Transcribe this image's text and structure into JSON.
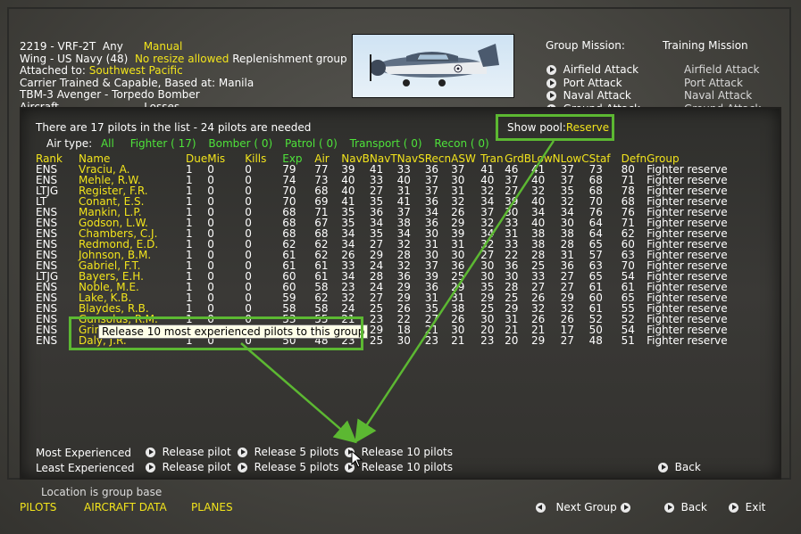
{
  "group": {
    "line1_id": "2219 - VRF-2T",
    "line1_any": "Any",
    "line1_manual": "Manual",
    "line2_wing": "Wing - US Navy (48)",
    "line2_resize": "No resize allowed",
    "line2_replenish": "Replenishment group",
    "line3_label": "Attached to:",
    "line3_value": "Southwest Pacific",
    "line4": "Carrier Trained & Capable, Based at:  Manila",
    "line5": "TBM-3 Avenger - Torpedo Bomber",
    "line6_a": "Aircraft",
    "line6_b": "Losses"
  },
  "missions": {
    "header_group": "Group Mission:",
    "header_training": "Training Mission",
    "items": [
      {
        "group": "Airfield Attack",
        "training": "Airfield Attack"
      },
      {
        "group": "Port Attack",
        "training": "Port Attack"
      },
      {
        "group": "Naval Attack",
        "training": "Naval Attack"
      },
      {
        "group": "Ground Attack",
        "training": "Ground Attack"
      }
    ]
  },
  "panel": {
    "summary": "There are 17 pilots in the list - 24 pilots are needed",
    "show_pool_label": "Show pool:",
    "show_pool_value": "Reserve",
    "air_type_label": "Air type:",
    "filters": [
      "All",
      "Fighter ( 17)",
      "Bomber ( 0)",
      "Patrol ( 0)",
      "Transport ( 0)",
      "Recon ( 0)"
    ]
  },
  "columns": [
    "Rank",
    "Name",
    "Due",
    "Mis",
    "Kills",
    "Exp",
    "Air",
    "NavB",
    "NavT",
    "NavS",
    "Recn",
    "ASW",
    "Tran",
    "GrdB",
    "LowN",
    "LowC",
    "Staf",
    "Defn",
    "Group"
  ],
  "pilots": [
    [
      "ENS",
      "Vraciu, A.",
      "1",
      "0",
      "0",
      "79",
      "77",
      "39",
      "41",
      "33",
      "36",
      "37",
      "41",
      "46",
      "41",
      "37",
      "73",
      "80",
      "Fighter reserve"
    ],
    [
      "ENS",
      "Mehle, R.W.",
      "1",
      "0",
      "0",
      "74",
      "73",
      "40",
      "33",
      "40",
      "37",
      "30",
      "40",
      "37",
      "40",
      "37",
      "68",
      "71",
      "Fighter reserve"
    ],
    [
      "LTJG",
      "Register, F.R.",
      "1",
      "0",
      "0",
      "70",
      "68",
      "40",
      "27",
      "31",
      "37",
      "31",
      "32",
      "27",
      "32",
      "35",
      "68",
      "78",
      "Fighter reserve"
    ],
    [
      "LT",
      "Conant, E.S.",
      "1",
      "0",
      "0",
      "70",
      "69",
      "41",
      "35",
      "41",
      "36",
      "32",
      "34",
      "39",
      "40",
      "32",
      "70",
      "68",
      "Fighter reserve"
    ],
    [
      "ENS",
      "Mankin, L.P.",
      "1",
      "0",
      "0",
      "68",
      "71",
      "35",
      "36",
      "37",
      "34",
      "26",
      "37",
      "30",
      "34",
      "34",
      "76",
      "76",
      "Fighter reserve"
    ],
    [
      "ENS",
      "Godson, L.W.",
      "1",
      "0",
      "0",
      "68",
      "67",
      "35",
      "34",
      "38",
      "36",
      "29",
      "32",
      "33",
      "40",
      "30",
      "64",
      "71",
      "Fighter reserve"
    ],
    [
      "ENS",
      "Chambers, C.J.",
      "1",
      "0",
      "0",
      "68",
      "68",
      "34",
      "35",
      "34",
      "30",
      "39",
      "34",
      "31",
      "38",
      "38",
      "64",
      "62",
      "Fighter reserve"
    ],
    [
      "ENS",
      "Redmond, E.D.",
      "1",
      "0",
      "0",
      "62",
      "62",
      "34",
      "27",
      "32",
      "31",
      "31",
      "32",
      "33",
      "38",
      "28",
      "65",
      "60",
      "Fighter reserve"
    ],
    [
      "ENS",
      "Johnson, B.M.",
      "1",
      "0",
      "0",
      "61",
      "62",
      "26",
      "29",
      "28",
      "30",
      "30",
      "27",
      "22",
      "28",
      "31",
      "57",
      "63",
      "Fighter reserve"
    ],
    [
      "ENS",
      "Gabriel, F.T.",
      "1",
      "0",
      "0",
      "61",
      "61",
      "33",
      "24",
      "32",
      "37",
      "36",
      "30",
      "36",
      "25",
      "36",
      "63",
      "70",
      "Fighter reserve"
    ],
    [
      "LTJG",
      "Bayers, E.H.",
      "1",
      "0",
      "0",
      "60",
      "61",
      "34",
      "28",
      "36",
      "39",
      "25",
      "30",
      "30",
      "33",
      "27",
      "65",
      "54",
      "Fighter reserve"
    ],
    [
      "ENS",
      "Noble, M.E.",
      "1",
      "0",
      "0",
      "60",
      "58",
      "23",
      "24",
      "29",
      "36",
      "29",
      "35",
      "28",
      "27",
      "27",
      "61",
      "61",
      "Fighter reserve"
    ],
    [
      "ENS",
      "Lake, K.B.",
      "1",
      "0",
      "0",
      "59",
      "62",
      "32",
      "27",
      "29",
      "31",
      "31",
      "29",
      "25",
      "26",
      "29",
      "60",
      "65",
      "Fighter reserve"
    ],
    [
      "ENS",
      "Blaydes, R.B.",
      "1",
      "0",
      "0",
      "58",
      "58",
      "24",
      "25",
      "26",
      "35",
      "38",
      "25",
      "29",
      "32",
      "32",
      "61",
      "55",
      "Fighter reserve"
    ],
    [
      "ENS",
      "Gunsolus, R.M.",
      "1",
      "0",
      "0",
      "53",
      "55",
      "21",
      "23",
      "22",
      "27",
      "26",
      "30",
      "31",
      "26",
      "26",
      "52",
      "52",
      "Fighter reserve"
    ],
    [
      "ENS",
      "Grimes, ...",
      "1",
      "0",
      "0",
      "52",
      "55",
      "25",
      "29",
      "18",
      "21",
      "30",
      "20",
      "21",
      "21",
      "17",
      "50",
      "54",
      "Fighter reserve"
    ],
    [
      "ENS",
      "Daly, J.R.",
      "1",
      "0",
      "0",
      "50",
      "48",
      "23",
      "25",
      "30",
      "23",
      "21",
      "23",
      "20",
      "29",
      "27",
      "48",
      "51",
      "Fighter reserve"
    ]
  ],
  "tooltip": "Release 10 most experienced pilots to this group",
  "release": {
    "most_label": "Most Experienced",
    "least_label": "Least Experienced",
    "release_pilot": "Release pilot",
    "release_5": "Release 5 pilots",
    "release_10": "Release 10 pilots",
    "back": "Back"
  },
  "footer": {
    "location": "Location is group base",
    "tabs": [
      "PILOTS",
      "AIRCRAFT DATA",
      "PLANES"
    ],
    "next_group": "Next Group",
    "back": "Back",
    "exit": "Exit"
  },
  "colors": {
    "yellow": "#f2e41c",
    "green": "#4ee23a",
    "highlight_box": "#5cb832"
  }
}
